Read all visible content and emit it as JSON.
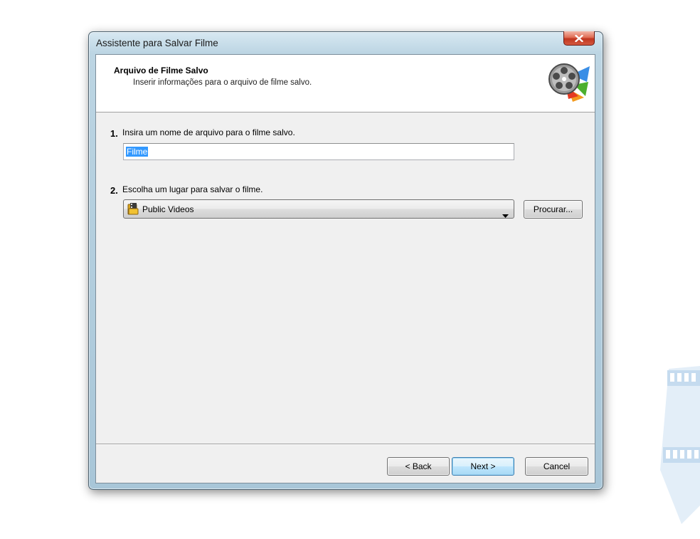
{
  "window": {
    "title": "Assistente para Salvar Filme"
  },
  "header": {
    "title": "Arquivo de Filme Salvo",
    "subtitle": "Inserir informações para o arquivo de filme salvo."
  },
  "step1": {
    "number": "1.",
    "label": "Insira um nome de arquivo para o filme salvo.",
    "value": "Filme"
  },
  "step2": {
    "number": "2.",
    "label": "Escolha um lugar para salvar o filme.",
    "selected": "Public Videos",
    "browse_label": "Procurar..."
  },
  "footer": {
    "back_label": "< Back",
    "next_label": "Next >",
    "cancel_label": "Cancel"
  },
  "icons": {
    "close": "close-icon",
    "header": "film-reel-icon",
    "folder": "videos-folder-icon",
    "dropdown": "chevron-down-icon",
    "decoration": "film-strip-icon"
  },
  "colors": {
    "selection": "#3399ff",
    "default_button_border": "#3c7fb1",
    "close_button": "#c0361f"
  }
}
